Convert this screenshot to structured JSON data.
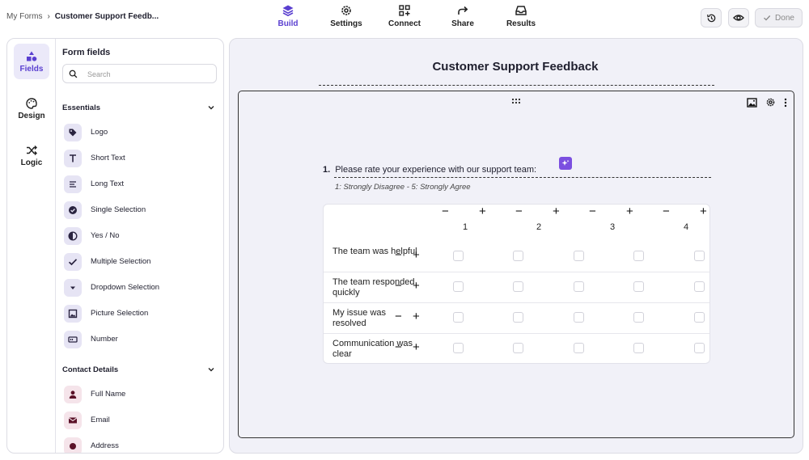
{
  "breadcrumb": {
    "root": "My Forms",
    "separator": "›",
    "current": "Customer Support Feedb..."
  },
  "nav_tabs": [
    {
      "label": "Build",
      "icon": "layers-icon",
      "active": true
    },
    {
      "label": "Settings",
      "icon": "gear-icon",
      "active": false
    },
    {
      "label": "Connect",
      "icon": "connect-icon",
      "active": false
    },
    {
      "label": "Share",
      "icon": "share-icon",
      "active": false
    },
    {
      "label": "Results",
      "icon": "inbox-icon",
      "active": false
    }
  ],
  "actions": {
    "history_icon": "history-icon",
    "preview_icon": "eye-icon",
    "done_label": "Done"
  },
  "rail": [
    {
      "label": "Fields",
      "icon": "shapes-icon",
      "active": true
    },
    {
      "label": "Design",
      "icon": "palette-icon",
      "active": false
    },
    {
      "label": "Logic",
      "icon": "shuffle-icon",
      "active": false
    }
  ],
  "fields_panel": {
    "title": "Form fields",
    "search_placeholder": "Search",
    "sections": [
      {
        "label": "Essentials",
        "items": [
          {
            "label": "Logo",
            "icon": "tag-icon"
          },
          {
            "label": "Short Text",
            "icon": "text-t-icon"
          },
          {
            "label": "Long Text",
            "icon": "long-text-icon"
          },
          {
            "label": "Single Selection",
            "icon": "radio-check-icon"
          },
          {
            "label": "Yes / No",
            "icon": "half-circle-icon"
          },
          {
            "label": "Multiple Selection",
            "icon": "checkmark-icon"
          },
          {
            "label": "Dropdown Selection",
            "icon": "dropdown-icon"
          },
          {
            "label": "Picture Selection",
            "icon": "picture-icon"
          },
          {
            "label": "Number",
            "icon": "number-icon"
          }
        ]
      },
      {
        "label": "Contact Details",
        "items": [
          {
            "label": "Full Name",
            "icon": "person-icon"
          },
          {
            "label": "Email",
            "icon": "envelope-icon"
          },
          {
            "label": "Address",
            "icon": "location-icon"
          }
        ]
      }
    ]
  },
  "form": {
    "title": "Customer Support Feedback",
    "question": {
      "number": "1.",
      "text": "Please rate your experience with our support team:",
      "description": "1: Strongly Disagree - 5: Strongly Agree",
      "columns": [
        "1",
        "2",
        "3",
        "4"
      ],
      "rows": [
        "The team was helpful",
        "The team responded quickly",
        "My issue was resolved",
        "Communication was clear"
      ],
      "checkbox_columns": 5
    }
  },
  "colors": {
    "accent": "#5a3fd0",
    "accent_light": "#ebe9f9",
    "canvas_bg": "#f1f1f8",
    "ai_button": "#7b4fe0"
  }
}
